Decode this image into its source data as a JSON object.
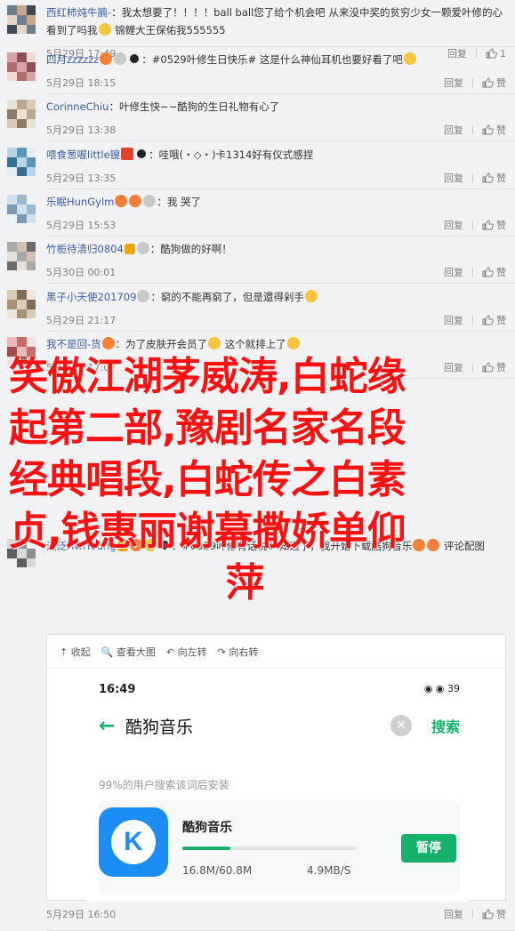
{
  "comments": [
    {
      "text_parts": [
        {
          "t": "西红柿炖牛腩-",
          "u": true
        },
        {
          "t": "：我太想要了！！！！ball  ball您了给个机会吧 从来没中奖的贫穷少女一颗爱叶修的心看到了吗我"
        },
        {
          "e": "y"
        },
        {
          "t": " 锦鲤大王保佑我555555"
        }
      ],
      "time": "5月29日 17:49",
      "reply": "回复",
      "like": "1"
    },
    {
      "text_parts": [
        {
          "t": "四月zzzzzz",
          "u": true
        },
        {
          "e": "o"
        },
        {
          "e": "g"
        },
        {
          "e": "p"
        },
        {
          "t": "：#0529叶修生日快乐# 这是什么神仙耳机也要好看了吧"
        },
        {
          "e": "y"
        }
      ],
      "time": "5月29日 18:15",
      "reply": "回复",
      "like": "赞"
    },
    {
      "text_parts": [
        {
          "t": "CorinneChiu",
          "u": true
        },
        {
          "t": "：叶修生快~~酷狗的生日礼物有心了"
        }
      ],
      "time": "5月29日 13:38",
      "reply": "回复",
      "like": "赞"
    },
    {
      "text_parts": [
        {
          "t": "喂食葱喔little锼",
          "u": true
        },
        {
          "e": "r"
        },
        {
          "e": "p"
        },
        {
          "t": "：哇哦(・◇・)卡1314好有仪式感捏"
        }
      ],
      "time": "5月29日 13:35",
      "reply": "回复",
      "like": "赞"
    },
    {
      "text_parts": [
        {
          "t": "乐眠HunGylm",
          "u": true
        },
        {
          "e": "o"
        },
        {
          "e": "o"
        },
        {
          "e": "g"
        },
        {
          "t": "：我    哭了"
        }
      ],
      "time": "5月29日 15:53",
      "reply": "回复",
      "like": "赞"
    },
    {
      "text_parts": [
        {
          "t": "竹栀待清归0804",
          "u": true
        },
        {
          "e": "v"
        },
        {
          "e": "g"
        },
        {
          "t": "：酷狗做的好啊！"
        }
      ],
      "time": "5月30日 00:01",
      "reply": "回复",
      "like": "赞"
    },
    {
      "text_parts": [
        {
          "t": "黑子小天使201709",
          "u": true
        },
        {
          "e": "g"
        },
        {
          "t": "：窮的不能再窮了，但是還得剁手"
        },
        {
          "e": "y"
        }
      ],
      "time": "5月29日 21:17",
      "reply": "回复",
      "like": "赞"
    },
    {
      "text_parts": [
        {
          "t": "我不是回-货",
          "u": true
        },
        {
          "e": "o"
        },
        {
          "t": "：为了皮肤开会员了"
        },
        {
          "e": "y"
        },
        {
          "t": " 这个就排上了"
        },
        {
          "e": "y"
        }
      ],
      "time": "5月29日 17:07",
      "reply": "回复",
      "like": "赞"
    },
    {
      "text_parts": [
        {
          "t": "泛泛HwiYoung",
          "u": true
        },
        {
          "e": "v"
        },
        {
          "e": "o"
        },
        {
          "e": "y"
        },
        {
          "e": "p"
        },
        {
          "t": "：#0529叶修有话说# 知道了，我开始下载酷狗音乐"
        },
        {
          "e": "o"
        },
        {
          "e": "o"
        },
        {
          "t": " 评论配图"
        }
      ],
      "time": "5月29日 16:50",
      "reply": "回复",
      "like": "赞"
    }
  ],
  "overlay_lines": [
    "笑傲江湖茅威涛,白蛇缘",
    "起第二部,豫剧名家名段",
    "经典唱段,白蛇传之白素",
    "贞,钱惠丽谢幕撒娇单仰",
    "萍"
  ],
  "image_toolbar": {
    "collapse": "⇡ 收起",
    "view_large": "🔍 查看大图",
    "rotate_left": "↶ 向左转",
    "rotate_right": "↷ 向右转"
  },
  "phone": {
    "time": "16:49",
    "status_right": "◉ ◉ 39",
    "search_query": "酷狗音乐",
    "search_button": "搜索",
    "hint": "99%的用户搜索该词后安装",
    "app_name": "酷狗音乐",
    "progress": 0.277,
    "pause_button": "暂停",
    "size": "16.8M/60.8M",
    "speed": "4.9MB/S"
  }
}
